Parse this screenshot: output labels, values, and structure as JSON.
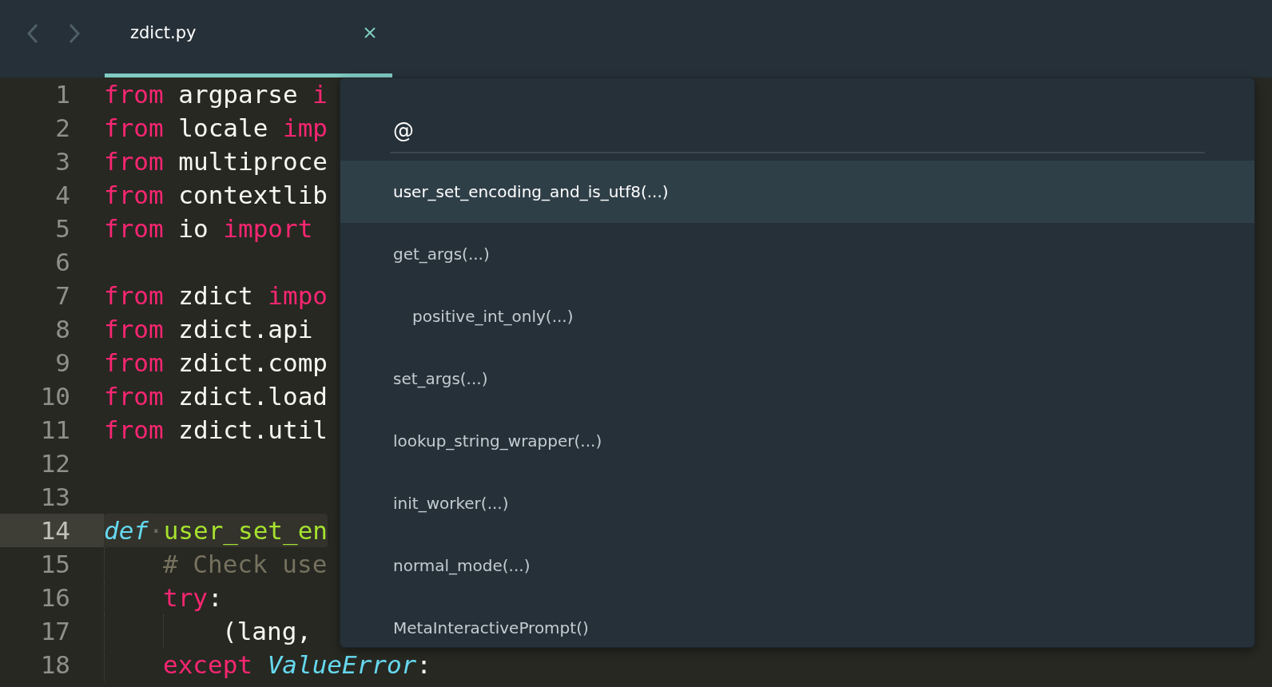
{
  "tabs": [
    {
      "label": "zdict.py",
      "selected": true
    }
  ],
  "code": [
    {
      "number": "1",
      "current": false,
      "tokens": [
        {
          "kind": "kw",
          "text": "from"
        },
        {
          "kind": "name",
          "text": " argparse "
        },
        {
          "kind": "kw",
          "text": "i"
        }
      ]
    },
    {
      "number": "2",
      "current": false,
      "tokens": [
        {
          "kind": "kw",
          "text": "from"
        },
        {
          "kind": "name",
          "text": " locale "
        },
        {
          "kind": "kw",
          "text": "imp"
        }
      ]
    },
    {
      "number": "3",
      "current": false,
      "tokens": [
        {
          "kind": "kw",
          "text": "from"
        },
        {
          "kind": "name",
          "text": " multiproce"
        }
      ]
    },
    {
      "number": "4",
      "current": false,
      "tokens": [
        {
          "kind": "kw",
          "text": "from"
        },
        {
          "kind": "name",
          "text": " contextlib"
        }
      ]
    },
    {
      "number": "5",
      "current": false,
      "tokens": [
        {
          "kind": "kw",
          "text": "from"
        },
        {
          "kind": "name",
          "text": " io "
        },
        {
          "kind": "kw",
          "text": "import"
        }
      ]
    },
    {
      "number": "6",
      "current": false
    },
    {
      "number": "7",
      "current": false,
      "tokens": [
        {
          "kind": "kw",
          "text": "from"
        },
        {
          "kind": "name",
          "text": " zdict "
        },
        {
          "kind": "kw",
          "text": "impo"
        }
      ]
    },
    {
      "number": "8",
      "current": false,
      "tokens": [
        {
          "kind": "kw",
          "text": "from"
        },
        {
          "kind": "name",
          "text": " zdict.api"
        }
      ]
    },
    {
      "number": "9",
      "current": false,
      "tokens": [
        {
          "kind": "kw",
          "text": "from"
        },
        {
          "kind": "name",
          "text": " zdict.comp"
        }
      ]
    },
    {
      "number": "10",
      "current": false,
      "tokens": [
        {
          "kind": "kw",
          "text": "from"
        },
        {
          "kind": "name",
          "text": " zdict.load"
        }
      ]
    },
    {
      "number": "11",
      "current": false,
      "tokens": [
        {
          "kind": "kw",
          "text": "from"
        },
        {
          "kind": "name",
          "text": " zdict.util"
        }
      ]
    },
    {
      "number": "12",
      "current": false
    },
    {
      "number": "13",
      "current": false
    },
    {
      "number": "14",
      "current": true,
      "tokens": [
        {
          "kind": "storage",
          "text": "def"
        },
        {
          "kind": "ws",
          "text": "·"
        },
        {
          "kind": "func",
          "text": "user_set_en"
        }
      ],
      "children": [
        {
          "number": "15",
          "current": false,
          "tokens": [
            {
              "kind": "comment",
              "text": "# Check use"
            }
          ]
        },
        {
          "number": "16",
          "current": false,
          "tokens": [
            {
              "kind": "kw",
              "text": "try"
            },
            {
              "kind": "name",
              "text": ":"
            }
          ],
          "children": [
            {
              "number": "17",
              "current": false,
              "tokens": [
                {
                  "kind": "name",
                  "text": "(lang,"
                }
              ]
            }
          ]
        },
        {
          "number": "18",
          "current": false,
          "tokens": [
            {
              "kind": "kw",
              "text": "except"
            },
            {
              "kind": "storage",
              "text": " ValueError"
            },
            {
              "kind": "name",
              "text": ":"
            }
          ]
        }
      ]
    }
  ],
  "goto": {
    "query": "@",
    "items": [
      {
        "label": "user_set_encoding_and_is_utf8(...)",
        "selected": true
      },
      {
        "label": "get_args(...)",
        "selected": false,
        "children": [
          {
            "label": "positive_int_only(...)",
            "selected": false
          }
        ]
      },
      {
        "label": "set_args(...)",
        "selected": false
      },
      {
        "label": "lookup_string_wrapper(...)",
        "selected": false
      },
      {
        "label": "init_worker(...)",
        "selected": false
      },
      {
        "label": "normal_mode(...)",
        "selected": false
      },
      {
        "label": "MetaInteractivePrompt()",
        "selected": false
      }
    ]
  }
}
